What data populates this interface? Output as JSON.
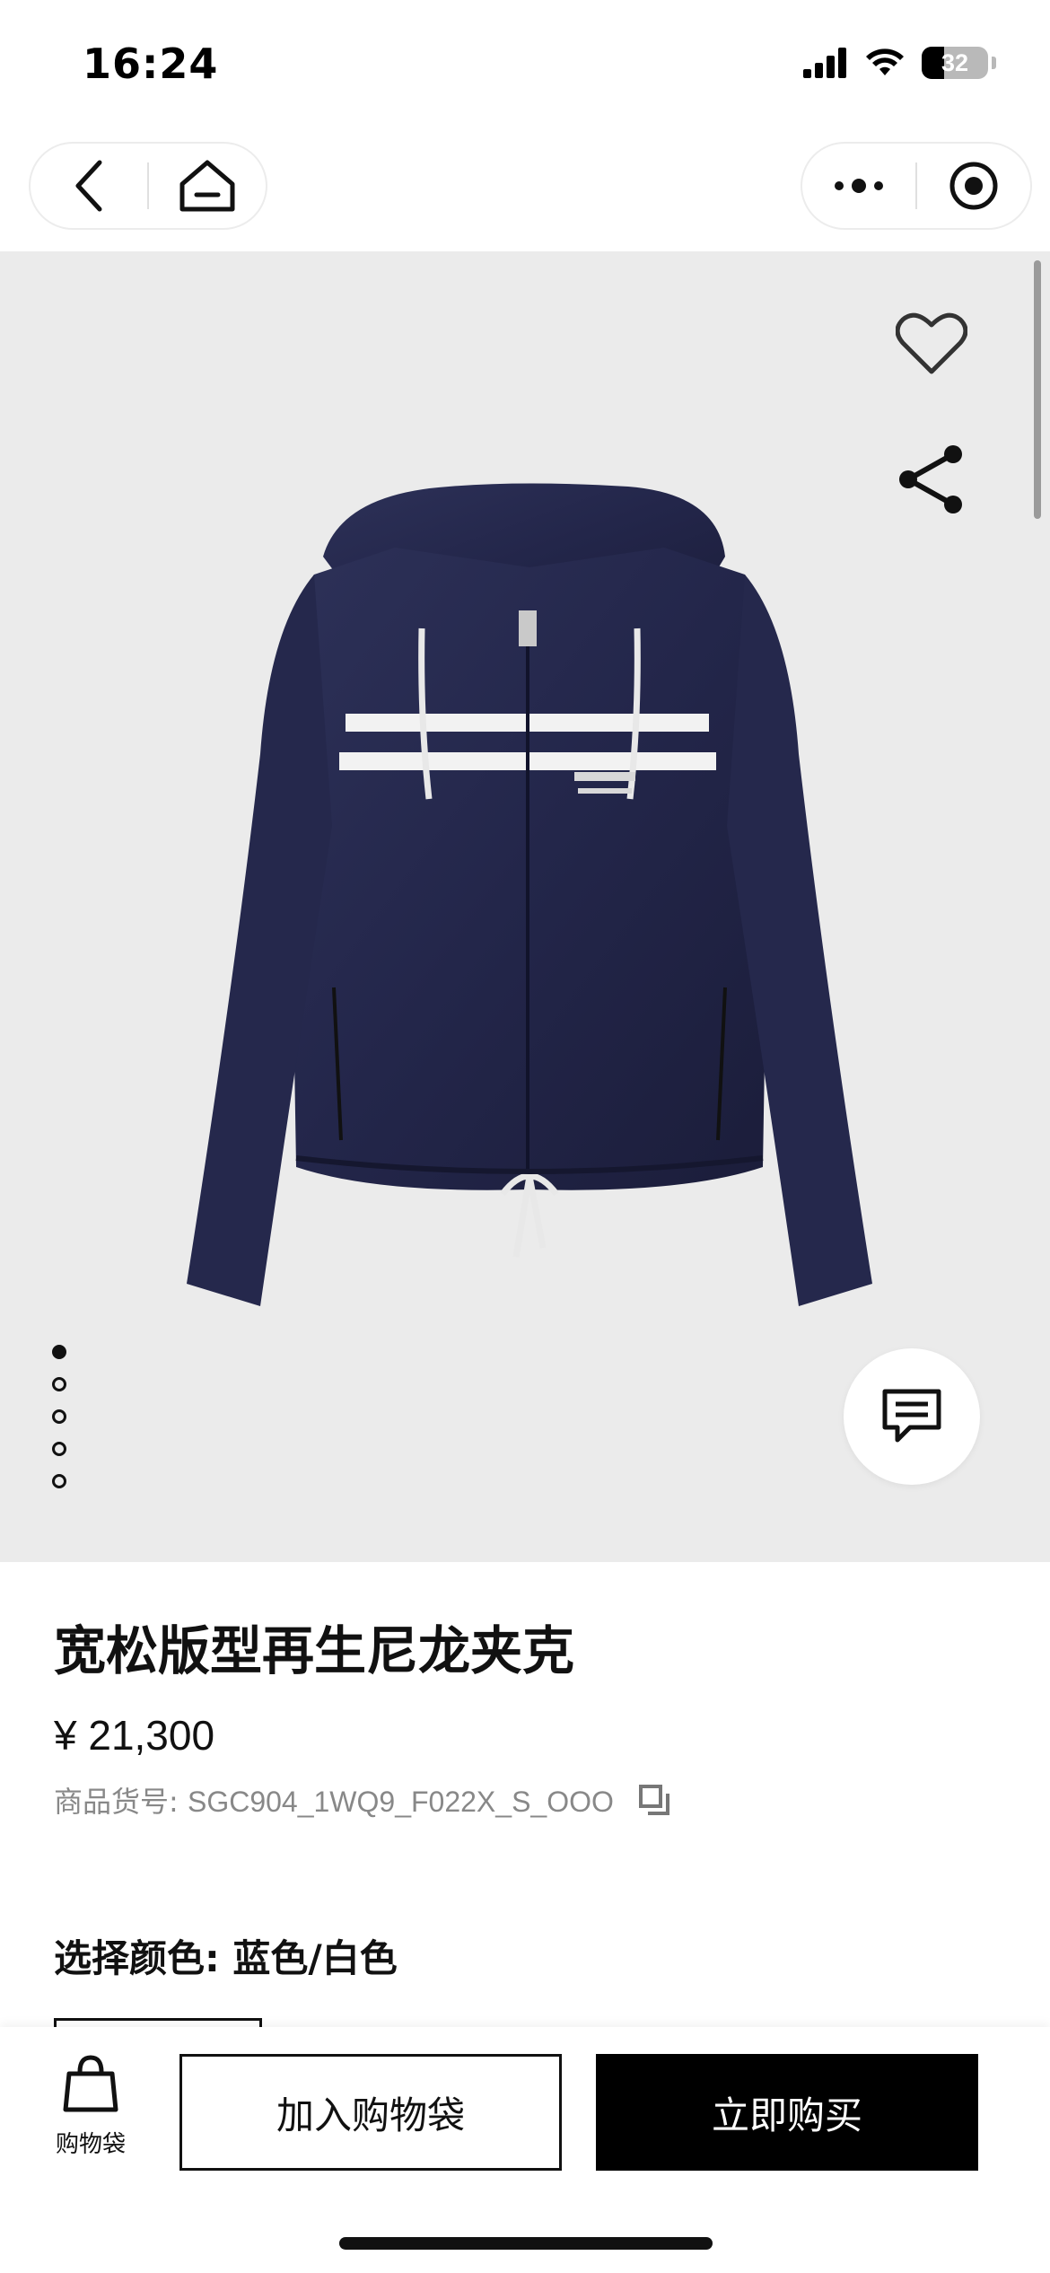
{
  "status_bar": {
    "time": "16:24",
    "battery": "32",
    "icons": [
      "signal-icon",
      "wifi-icon",
      "battery-icon"
    ]
  },
  "nav": {
    "left_icons": [
      "back-arrow-icon",
      "home-icon"
    ],
    "right_icons": [
      "more-dots-icon",
      "target-icon"
    ]
  },
  "hero": {
    "image": "navy-nylon-hooded-jacket-photo",
    "image_count": 5,
    "active_index": 0,
    "favorite_icon": "heart-icon",
    "share_icon": "share-icon",
    "chat_icon": "chat-bubble-icon"
  },
  "product": {
    "title": "宽松版型再生尼龙夹克",
    "price": "¥ 21,300",
    "sku_label": "商品货号:",
    "sku_value": "SGC904_1WQ9_F022X_S_OOO",
    "copy_icon": "copy-icon",
    "color_label": "选择颜色:",
    "color_value": "蓝色/白色"
  },
  "bottom_bar": {
    "bag_label": "购物袋",
    "bag_icon": "shopping-bag-icon",
    "add_to_bag": "加入购物袋",
    "buy_now": "立即购买"
  },
  "colors": {
    "navy": "#23264a",
    "accent_black": "#000000",
    "image_bg": "#ebebeb"
  }
}
